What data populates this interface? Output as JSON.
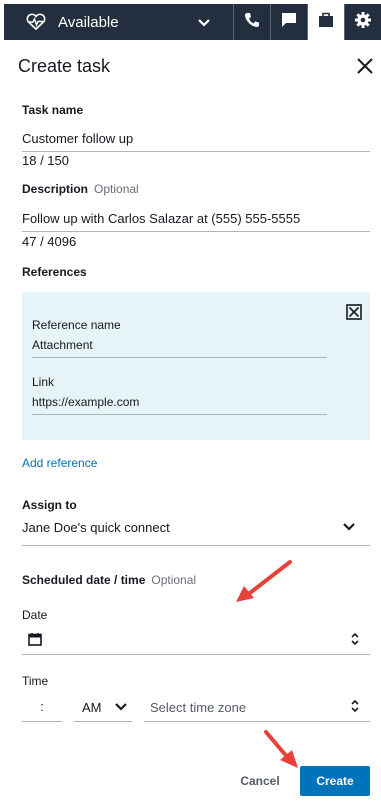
{
  "topbar": {
    "status_label": "Available",
    "status_icon": "heartbeat-icon",
    "icons": [
      "phone-icon",
      "chat-icon",
      "briefcase-icon",
      "gear-icon"
    ],
    "active_tab": "briefcase-icon"
  },
  "header": {
    "title": "Create task"
  },
  "task_name": {
    "label": "Task name",
    "value": "Customer follow up",
    "counter": "18 / 150"
  },
  "description": {
    "label": "Description",
    "optional": "Optional",
    "value": "Follow up with Carlos Salazar at (555) 555-5555",
    "counter": "47 / 4096"
  },
  "references": {
    "label": "References",
    "reference_name_label": "Reference name",
    "reference_name_value": "Attachment",
    "link_label": "Link",
    "link_value": "https://example.com",
    "add_label": "Add reference"
  },
  "assign": {
    "label": "Assign to",
    "value": "Jane Doe's quick connect"
  },
  "scheduled": {
    "label": "Scheduled date / time",
    "optional": "Optional",
    "date_label": "Date",
    "time_label": "Time",
    "time_value": ":",
    "ampm_value": "AM",
    "timezone_placeholder": "Select time zone"
  },
  "actions": {
    "cancel": "Cancel",
    "create": "Create"
  },
  "colors": {
    "topbar": "#232f3e",
    "accent": "#0073bb",
    "reference_bg": "#e6f4f7",
    "arrow": "#e8413a"
  }
}
